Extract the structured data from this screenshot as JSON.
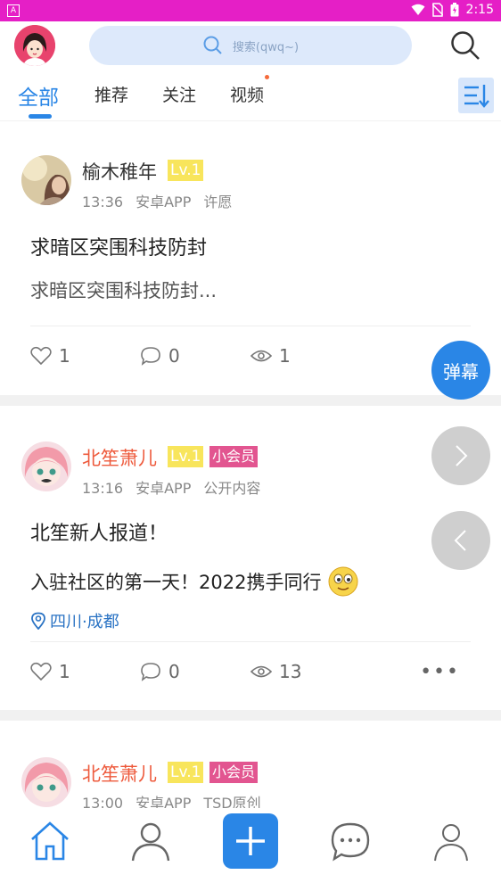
{
  "status_bar": {
    "app_letter": "A",
    "time": "2:15"
  },
  "search": {
    "placeholder": "搜索(qwq~)"
  },
  "tabs": [
    {
      "label": "全部",
      "active": true
    },
    {
      "label": "推荐"
    },
    {
      "label": "关注"
    },
    {
      "label": "视频",
      "has_dot": true
    }
  ],
  "posts": [
    {
      "author": "榆木稚年",
      "level": "Lv.1",
      "time": "13:36",
      "platform": "安卓APP",
      "tag": "许愿",
      "title": "求暗区突围科技防封",
      "body": "求暗区突围科技防封...",
      "likes": "1",
      "comments": "0",
      "views": "1"
    },
    {
      "author": "北笙萧儿",
      "level": "Lv.1",
      "badge": "小会员",
      "time": "13:16",
      "platform": "安卓APP",
      "tag": "公开内容",
      "title": "北笙新人报道！",
      "body": "入驻社区的第一天！2022携手同行",
      "location": "四川·成都",
      "likes": "1",
      "comments": "0",
      "views": "13",
      "more": "•••"
    },
    {
      "author": "北笙萧儿",
      "level": "Lv.1",
      "badge": "小会员",
      "time": "13:00",
      "platform": "安卓APP",
      "tag": "TSD原创"
    }
  ],
  "float": {
    "danmu": "弹幕"
  },
  "colors": {
    "accent": "#2a86e6",
    "status_bar": "#e51fc6",
    "name_pink": "#ee5a3c",
    "level_bg": "#f8e55c",
    "vip_bg": "#e25590"
  }
}
